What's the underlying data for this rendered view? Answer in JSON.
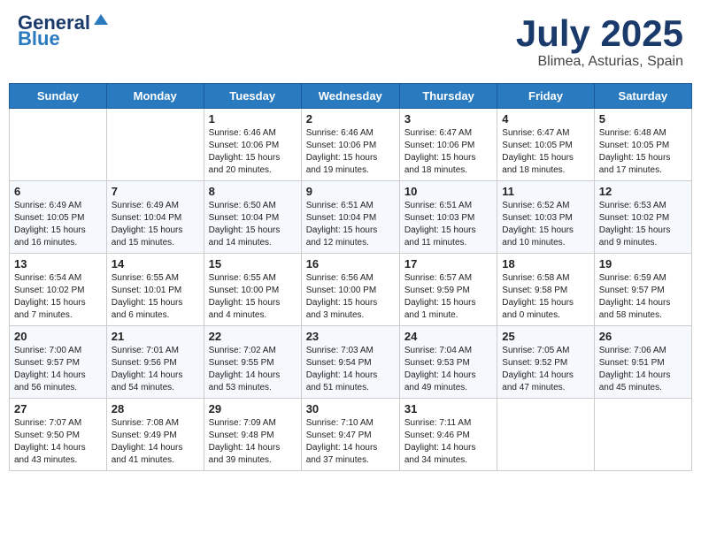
{
  "header": {
    "logo_general": "General",
    "logo_blue": "Blue",
    "month_title": "July 2025",
    "location": "Blimea, Asturias, Spain"
  },
  "days_of_week": [
    "Sunday",
    "Monday",
    "Tuesday",
    "Wednesday",
    "Thursday",
    "Friday",
    "Saturday"
  ],
  "weeks": [
    [
      {
        "day": "",
        "content": ""
      },
      {
        "day": "",
        "content": ""
      },
      {
        "day": "1",
        "content": "Sunrise: 6:46 AM\nSunset: 10:06 PM\nDaylight: 15 hours\nand 20 minutes."
      },
      {
        "day": "2",
        "content": "Sunrise: 6:46 AM\nSunset: 10:06 PM\nDaylight: 15 hours\nand 19 minutes."
      },
      {
        "day": "3",
        "content": "Sunrise: 6:47 AM\nSunset: 10:06 PM\nDaylight: 15 hours\nand 18 minutes."
      },
      {
        "day": "4",
        "content": "Sunrise: 6:47 AM\nSunset: 10:05 PM\nDaylight: 15 hours\nand 18 minutes."
      },
      {
        "day": "5",
        "content": "Sunrise: 6:48 AM\nSunset: 10:05 PM\nDaylight: 15 hours\nand 17 minutes."
      }
    ],
    [
      {
        "day": "6",
        "content": "Sunrise: 6:49 AM\nSunset: 10:05 PM\nDaylight: 15 hours\nand 16 minutes."
      },
      {
        "day": "7",
        "content": "Sunrise: 6:49 AM\nSunset: 10:04 PM\nDaylight: 15 hours\nand 15 minutes."
      },
      {
        "day": "8",
        "content": "Sunrise: 6:50 AM\nSunset: 10:04 PM\nDaylight: 15 hours\nand 14 minutes."
      },
      {
        "day": "9",
        "content": "Sunrise: 6:51 AM\nSunset: 10:04 PM\nDaylight: 15 hours\nand 12 minutes."
      },
      {
        "day": "10",
        "content": "Sunrise: 6:51 AM\nSunset: 10:03 PM\nDaylight: 15 hours\nand 11 minutes."
      },
      {
        "day": "11",
        "content": "Sunrise: 6:52 AM\nSunset: 10:03 PM\nDaylight: 15 hours\nand 10 minutes."
      },
      {
        "day": "12",
        "content": "Sunrise: 6:53 AM\nSunset: 10:02 PM\nDaylight: 15 hours\nand 9 minutes."
      }
    ],
    [
      {
        "day": "13",
        "content": "Sunrise: 6:54 AM\nSunset: 10:02 PM\nDaylight: 15 hours\nand 7 minutes."
      },
      {
        "day": "14",
        "content": "Sunrise: 6:55 AM\nSunset: 10:01 PM\nDaylight: 15 hours\nand 6 minutes."
      },
      {
        "day": "15",
        "content": "Sunrise: 6:55 AM\nSunset: 10:00 PM\nDaylight: 15 hours\nand 4 minutes."
      },
      {
        "day": "16",
        "content": "Sunrise: 6:56 AM\nSunset: 10:00 PM\nDaylight: 15 hours\nand 3 minutes."
      },
      {
        "day": "17",
        "content": "Sunrise: 6:57 AM\nSunset: 9:59 PM\nDaylight: 15 hours\nand 1 minute."
      },
      {
        "day": "18",
        "content": "Sunrise: 6:58 AM\nSunset: 9:58 PM\nDaylight: 15 hours\nand 0 minutes."
      },
      {
        "day": "19",
        "content": "Sunrise: 6:59 AM\nSunset: 9:57 PM\nDaylight: 14 hours\nand 58 minutes."
      }
    ],
    [
      {
        "day": "20",
        "content": "Sunrise: 7:00 AM\nSunset: 9:57 PM\nDaylight: 14 hours\nand 56 minutes."
      },
      {
        "day": "21",
        "content": "Sunrise: 7:01 AM\nSunset: 9:56 PM\nDaylight: 14 hours\nand 54 minutes."
      },
      {
        "day": "22",
        "content": "Sunrise: 7:02 AM\nSunset: 9:55 PM\nDaylight: 14 hours\nand 53 minutes."
      },
      {
        "day": "23",
        "content": "Sunrise: 7:03 AM\nSunset: 9:54 PM\nDaylight: 14 hours\nand 51 minutes."
      },
      {
        "day": "24",
        "content": "Sunrise: 7:04 AM\nSunset: 9:53 PM\nDaylight: 14 hours\nand 49 minutes."
      },
      {
        "day": "25",
        "content": "Sunrise: 7:05 AM\nSunset: 9:52 PM\nDaylight: 14 hours\nand 47 minutes."
      },
      {
        "day": "26",
        "content": "Sunrise: 7:06 AM\nSunset: 9:51 PM\nDaylight: 14 hours\nand 45 minutes."
      }
    ],
    [
      {
        "day": "27",
        "content": "Sunrise: 7:07 AM\nSunset: 9:50 PM\nDaylight: 14 hours\nand 43 minutes."
      },
      {
        "day": "28",
        "content": "Sunrise: 7:08 AM\nSunset: 9:49 PM\nDaylight: 14 hours\nand 41 minutes."
      },
      {
        "day": "29",
        "content": "Sunrise: 7:09 AM\nSunset: 9:48 PM\nDaylight: 14 hours\nand 39 minutes."
      },
      {
        "day": "30",
        "content": "Sunrise: 7:10 AM\nSunset: 9:47 PM\nDaylight: 14 hours\nand 37 minutes."
      },
      {
        "day": "31",
        "content": "Sunrise: 7:11 AM\nSunset: 9:46 PM\nDaylight: 14 hours\nand 34 minutes."
      },
      {
        "day": "",
        "content": ""
      },
      {
        "day": "",
        "content": ""
      }
    ]
  ]
}
